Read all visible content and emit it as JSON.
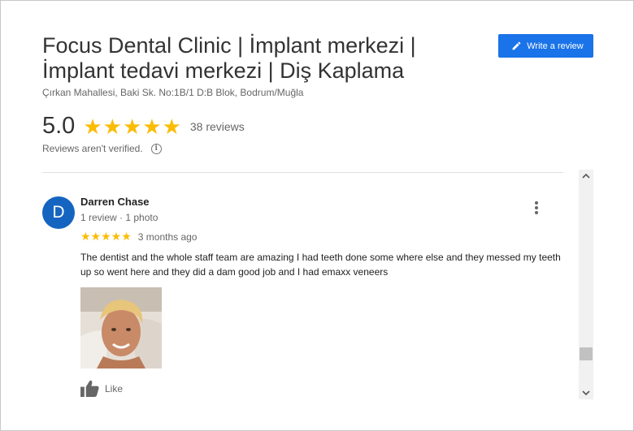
{
  "place": {
    "title": "Focus Dental Clinic | İmplant merkezi | İmplant tedavi merkezi | Diş Kaplama",
    "address": "Çırkan Mahallesi, Baki Sk. No:1B/1 D:B Blok, Bodrum/Muğla"
  },
  "actions": {
    "write_review_label": "Write a review",
    "write_review_icon": "pencil-icon"
  },
  "summary": {
    "rating": "5.0",
    "stars": "★★★★★",
    "rating_value": 5,
    "review_count": "38 reviews",
    "verification_note": "Reviews aren't verified.",
    "info_glyph": "i"
  },
  "review": {
    "avatar_letter": "D",
    "avatar_color": "#1565c0",
    "name": "Darren Chase",
    "meta": "1 review · 1 photo",
    "stars": "★★★★★",
    "rating_value": 5,
    "time": "3 months ago",
    "text": "The dentist and the whole staff team are amazing I had teeth done  some where else and they messed my teeth up so went here and they did a dam good job and I had emaxx veneers",
    "like_label": "Like",
    "like_icon": "thumbs-up-icon"
  },
  "colors": {
    "accent": "#1a73e8",
    "star": "#fbbc04"
  }
}
